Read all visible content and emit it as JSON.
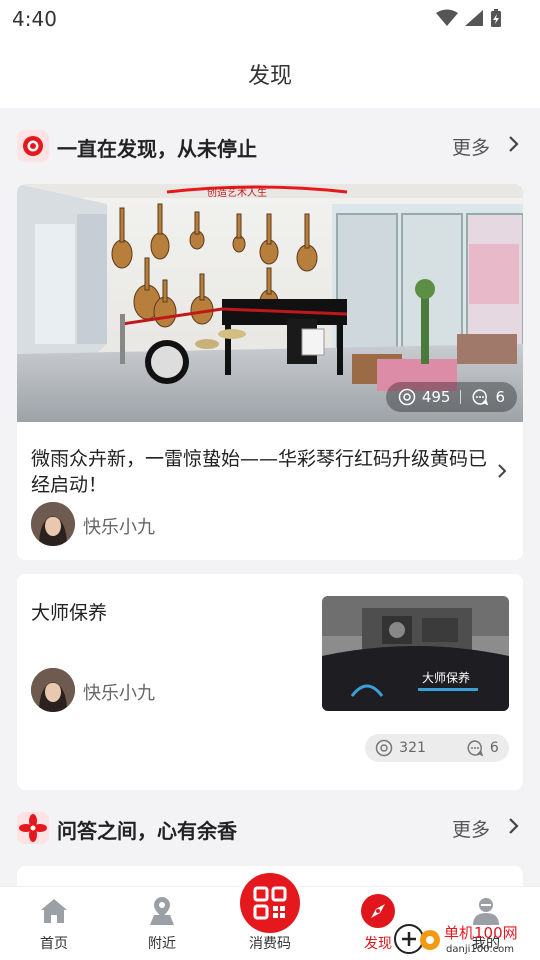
{
  "status_bar": {
    "time": "4:40"
  },
  "header": {
    "title": "发现"
  },
  "section_discover": {
    "title": "一直在发现，从未停止",
    "more_label": "更多",
    "icon": "target-icon",
    "accent": "#e5181e"
  },
  "post1": {
    "title": "微雨众卉新，一雷惊蛰始——华彩琴行红码升级黄码已经启动！",
    "author": "快乐小九",
    "views": "495",
    "comments": "6",
    "photo_sign": "创造艺术人生"
  },
  "post2": {
    "title": "大师保养",
    "author": "快乐小九",
    "views": "321",
    "comments": "6",
    "thumb_text": "大师保养"
  },
  "section_qa": {
    "title": "问答之间，心有余香",
    "more_label": "更多",
    "icon": "flower-icon"
  },
  "tabbar": {
    "tabs": [
      {
        "label": "首页",
        "icon": "home-icon"
      },
      {
        "label": "附近",
        "icon": "location-icon"
      },
      {
        "label": "消费码",
        "icon": "qrcode-icon"
      },
      {
        "label": "发现",
        "icon": "compass-icon",
        "active": true
      },
      {
        "label": "我的",
        "icon": "user-icon"
      }
    ],
    "active_color": "#e0161c"
  },
  "watermark": {
    "text": "单机100网",
    "domain": "danji100.com"
  }
}
